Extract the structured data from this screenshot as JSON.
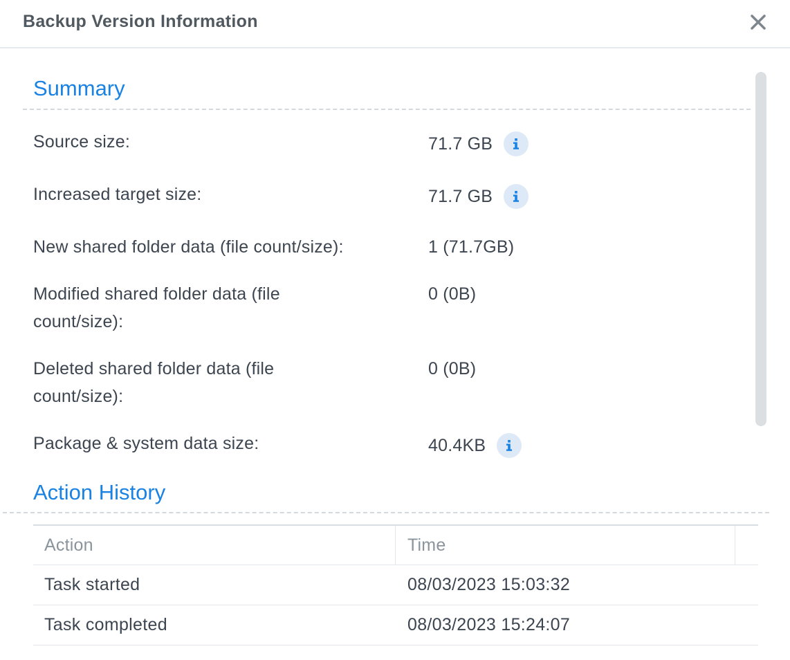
{
  "dialog": {
    "title": "Backup Version Information",
    "close_icon": "close-icon"
  },
  "summary": {
    "title": "Summary",
    "rows": [
      {
        "label": "Source size:",
        "value": "71.7 GB",
        "info_icon": "info-icon"
      },
      {
        "label": "Increased target size:",
        "value": "71.7 GB",
        "info_icon": "info-icon"
      },
      {
        "label": "New shared folder data (file count/size):",
        "value": "1 (71.7GB)"
      },
      {
        "label": "Modified shared folder data (file count/size):",
        "value": "0 (0B)"
      },
      {
        "label": "Deleted shared folder data (file count/size):",
        "value": "0 (0B)"
      },
      {
        "label": "Package & system data size:",
        "value": "40.4KB",
        "info_icon": "info-icon"
      }
    ]
  },
  "action_history": {
    "title": "Action History",
    "columns": [
      "Action",
      "Time"
    ],
    "rows": [
      {
        "action": "Task started",
        "time": "08/03/2023 15:03:32"
      },
      {
        "action": "Task completed",
        "time": "08/03/2023 15:24:07"
      }
    ]
  },
  "colors": {
    "accent": "#1a82e2",
    "text": "#3c4550",
    "info_bg": "#dde9f6"
  }
}
